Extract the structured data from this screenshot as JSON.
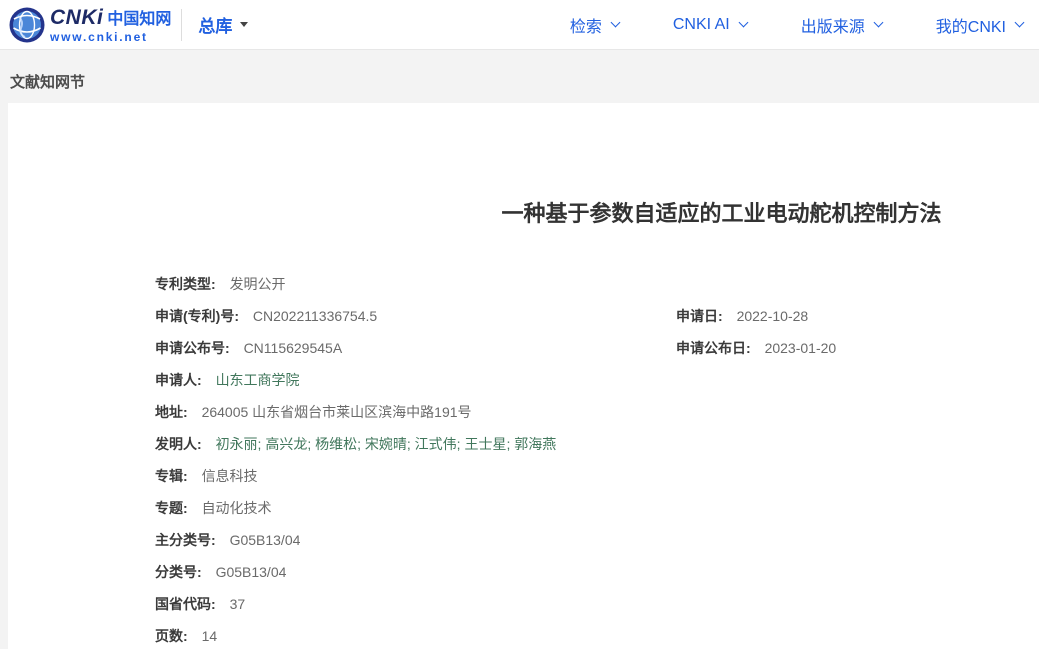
{
  "header": {
    "logo": {
      "brand": "CNKi",
      "brand_cn": "中国知网",
      "site": "www.cnki.net"
    },
    "library_label": "总库",
    "nav_items": [
      {
        "label": "检索"
      },
      {
        "label": "CNKI AI"
      },
      {
        "label": "出版来源"
      },
      {
        "label": "我的CNKI"
      }
    ]
  },
  "breadcrumb": {
    "title": "文献知网节"
  },
  "patent": {
    "title": "一种基于参数自适应的工业电动舵机控制方法",
    "rows": [
      {
        "label": "专利类型:",
        "value": "发明公开"
      },
      {
        "label": "申请(专利)号:",
        "value": "CN202211336754.5",
        "right_label": "申请日:",
        "right_value": "2022-10-28"
      },
      {
        "label": "申请公布号:",
        "value": "CN115629545A",
        "right_label": "申请公布日:",
        "right_value": "2023-01-20"
      },
      {
        "label": "申请人:",
        "value": "山东工商学院"
      },
      {
        "label": "地址:",
        "value": "264005 山东省烟台市莱山区滨海中路191号"
      },
      {
        "label": "发明人:",
        "value": "初永丽; 高兴龙; 杨维松; 宋婉晴; 江式伟; 王士星; 郭海燕"
      },
      {
        "label": "专辑:",
        "value": "信息科技"
      },
      {
        "label": "专题:",
        "value": "自动化技术"
      },
      {
        "label": "主分类号:",
        "value": "G05B13/04"
      },
      {
        "label": "分类号:",
        "value": "G05B13/04"
      },
      {
        "label": "国省代码:",
        "value": "37"
      },
      {
        "label": "页数:",
        "value": "14"
      }
    ]
  },
  "colors": {
    "brand_blue": "#2160e0",
    "logo_navy": "#1d2a66",
    "link_green": "#41775c",
    "label_dark": "#3a3a3a",
    "value_gray": "#6a6a6a"
  }
}
